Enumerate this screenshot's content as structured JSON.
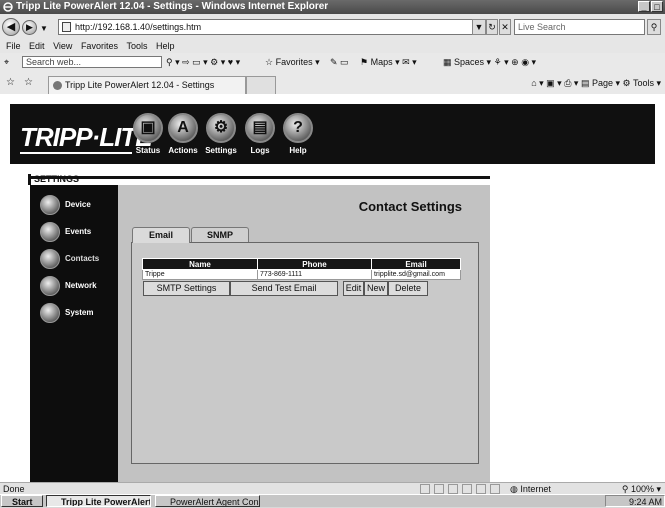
{
  "window": {
    "title": "Tripp Lite PowerAlert 12.04 - Settings - Windows Internet Explorer",
    "minimize": "_",
    "close": "×"
  },
  "browser": {
    "address": "http://192.168.1.40/settings.htm",
    "search_placeholder": "Live Search",
    "menu": [
      "File",
      "Edit",
      "View",
      "Favorites",
      "Tools",
      "Help"
    ],
    "search_web_placeholder": "Search web...",
    "links": {
      "favorites": "Favorites",
      "maps": "Maps",
      "spaces": "Spaces"
    },
    "tab_title": "Tripp Lite PowerAlert 12.04 - Settings",
    "commands": {
      "page": "Page",
      "tools": "Tools"
    }
  },
  "header": {
    "logo": "TRIPP·LITE",
    "nav": [
      {
        "label": "Status",
        "icon": "status-icon"
      },
      {
        "label": "Actions",
        "icon": "actions-icon"
      },
      {
        "label": "Settings",
        "icon": "settings-icon"
      },
      {
        "label": "Logs",
        "icon": "logs-icon"
      },
      {
        "label": "Help",
        "icon": "help-icon"
      }
    ]
  },
  "section_label": "SETTINGS",
  "sidebar": {
    "items": [
      {
        "label": "Device"
      },
      {
        "label": "Events"
      },
      {
        "label": "Contacts"
      },
      {
        "label": "Network"
      },
      {
        "label": "System"
      }
    ]
  },
  "main": {
    "title": "Contact Settings",
    "tabs": [
      {
        "label": "Email"
      },
      {
        "label": "SNMP"
      }
    ],
    "table": {
      "headers": [
        "Name",
        "Phone",
        "Email"
      ],
      "rows": [
        [
          "Trippe",
          "773-869-1111",
          "tripplite.sd@gmail.com"
        ]
      ]
    },
    "buttons": {
      "smtp": "SMTP Settings",
      "send_test": "Send Test Email",
      "edit": "Edit",
      "new": "New",
      "delete": "Delete"
    }
  },
  "status": {
    "text": "Done",
    "zone": "Internet",
    "zoom": "100%"
  },
  "taskbar": {
    "start": "Start",
    "items": [
      "Tripp Lite PowerAlert ...",
      "PowerAlert Agent Consol..."
    ],
    "clock": "9:24 AM"
  }
}
